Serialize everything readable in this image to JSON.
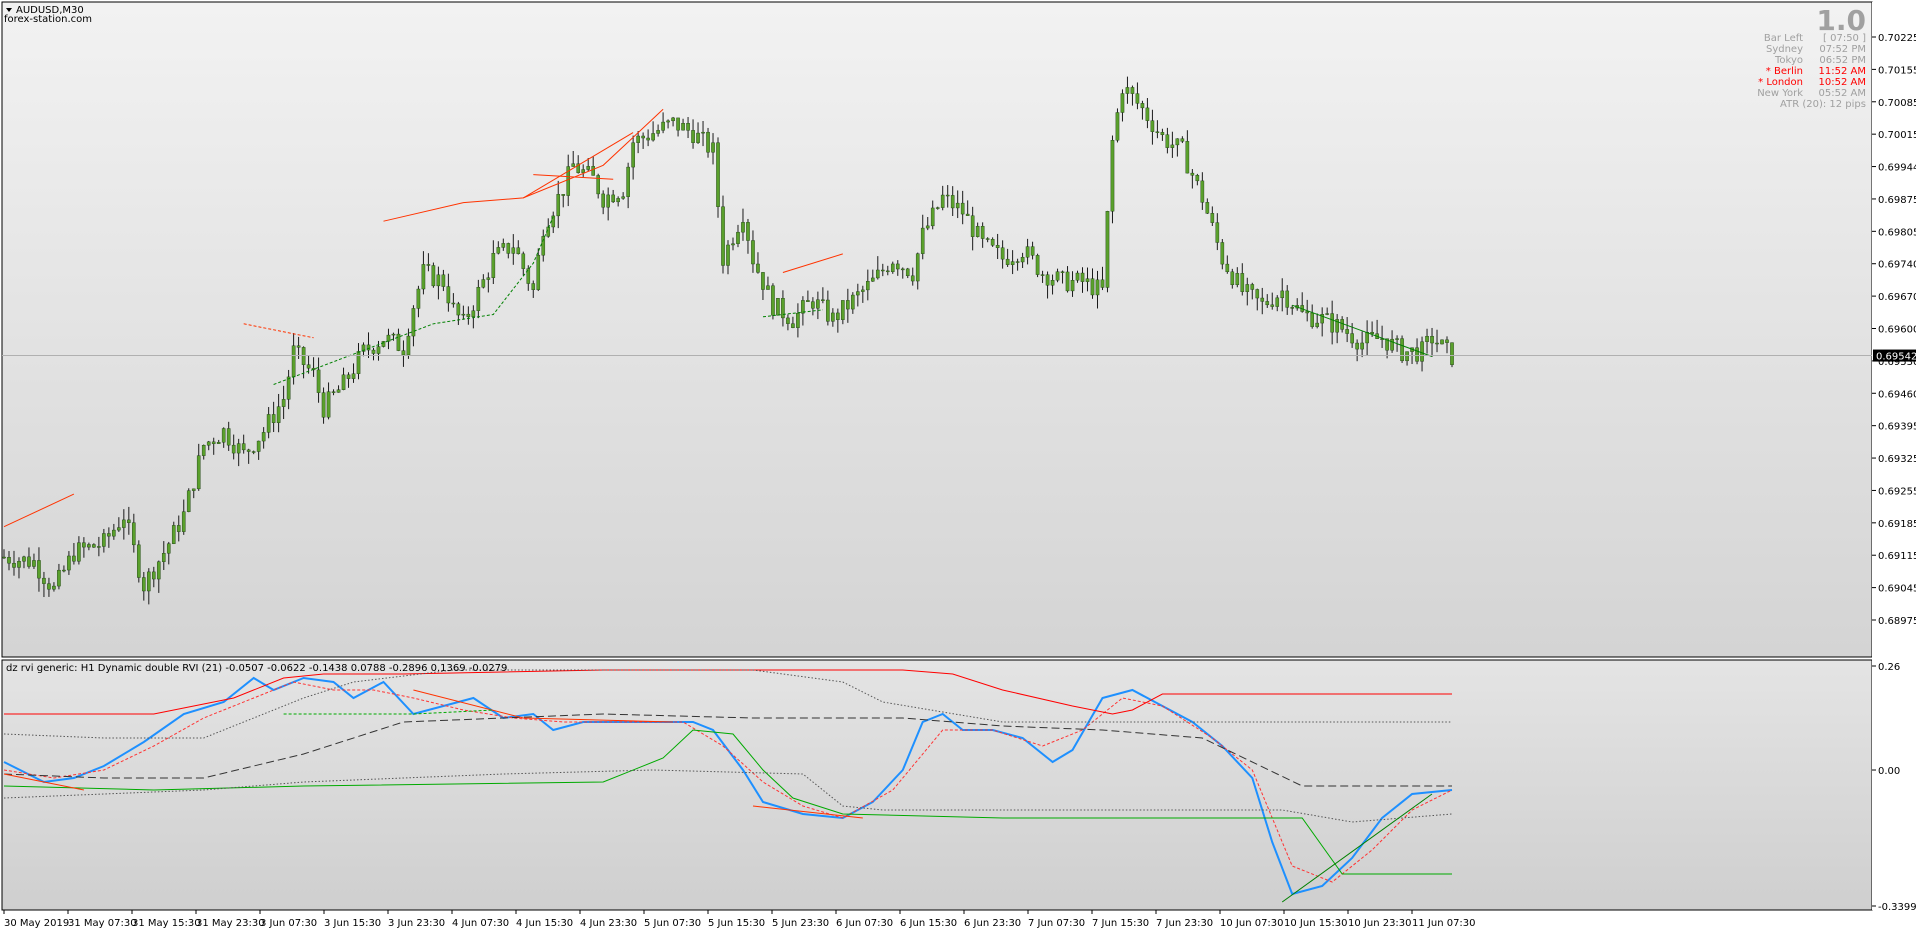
{
  "chart_window": {
    "symbol_label": "AUDUSD,M30",
    "watermark": "forex-station.com",
    "current_price_tag": "0.69542"
  },
  "info_panel": {
    "big_number": "1.0",
    "rows": [
      {
        "label": "Bar Left",
        "value": "[ 07:50 ]",
        "color": "#a0a0a0"
      },
      {
        "label": "Sydney",
        "value": "07:52 PM",
        "color": "#a0a0a0"
      },
      {
        "label": "Tokyo",
        "value": "06:52 PM",
        "color": "#a0a0a0"
      },
      {
        "label": "* Berlin",
        "value": "11:52 AM",
        "color": "#ff0000"
      },
      {
        "label": "* London",
        "value": "10:52 AM",
        "color": "#ff0000"
      },
      {
        "label": "New York",
        "value": "05:52 AM",
        "color": "#a0a0a0"
      }
    ],
    "atr_text": "ATR (20): 12 pips"
  },
  "indicator": {
    "title": "dz rvi generic: H1  Dynamic double RVI (21) -0.0507 -0.0622 -0.1438 0.0788 -0.2896 0.1369 -0.0279",
    "axis_labels": [
      "0.26",
      "0.00",
      "-0.3399"
    ]
  },
  "chart_data": {
    "type": "candlestick",
    "price_axis_labels": [
      "0.70225",
      "0.70155",
      "0.70085",
      "0.70015",
      "0.69944",
      "0.69875",
      "0.69805",
      "0.69740",
      "0.69670",
      "0.69600",
      "0.69530",
      "0.69460",
      "0.69395",
      "0.69325",
      "0.69255",
      "0.69185",
      "0.69115",
      "0.69045",
      "0.68975"
    ],
    "ylim": [
      0.68975,
      0.70225
    ],
    "last_price": 0.69542,
    "time_axis_labels": [
      "30 May 2019",
      "31 May 07:30",
      "31 May 15:30",
      "31 May 23:30",
      "3 Jun 07:30",
      "3 Jun 15:30",
      "3 Jun 23:30",
      "4 Jun 07:30",
      "4 Jun 15:30",
      "4 Jun 23:30",
      "5 Jun 07:30",
      "5 Jun 15:30",
      "5 Jun 23:30",
      "6 Jun 07:30",
      "6 Jun 15:30",
      "6 Jun 23:30",
      "7 Jun 07:30",
      "7 Jun 15:30",
      "7 Jun 23:30",
      "10 Jun 07:30",
      "10 Jun 15:30",
      "10 Jun 23:30",
      "11 Jun 07:30"
    ],
    "close_path": [
      [
        0,
        0.6911
      ],
      [
        6,
        0.691
      ],
      [
        10,
        0.6904
      ],
      [
        14,
        0.6912
      ],
      [
        20,
        0.6914
      ],
      [
        24,
        0.692
      ],
      [
        28,
        0.6905
      ],
      [
        32,
        0.6912
      ],
      [
        36,
        0.692
      ],
      [
        40,
        0.6935
      ],
      [
        44,
        0.6938
      ],
      [
        48,
        0.6933
      ],
      [
        52,
        0.6938
      ],
      [
        56,
        0.6945
      ],
      [
        58,
        0.6955
      ],
      [
        62,
        0.695
      ],
      [
        64,
        0.6943
      ],
      [
        68,
        0.6948
      ],
      [
        72,
        0.6955
      ],
      [
        76,
        0.6958
      ],
      [
        80,
        0.6956
      ],
      [
        82,
        0.6965
      ],
      [
        84,
        0.6972
      ],
      [
        88,
        0.697
      ],
      [
        90,
        0.6964
      ],
      [
        92,
        0.6961
      ],
      [
        96,
        0.697
      ],
      [
        98,
        0.6975
      ],
      [
        102,
        0.6978
      ],
      [
        106,
        0.6968
      ],
      [
        108,
        0.6982
      ],
      [
        112,
        0.699
      ],
      [
        114,
        0.6995
      ],
      [
        118,
        0.6992
      ],
      [
        120,
        0.6988
      ],
      [
        124,
        0.699
      ],
      [
        126,
        0.7
      ],
      [
        130,
        0.7002
      ],
      [
        134,
        0.7004
      ],
      [
        138,
        0.7002
      ],
      [
        142,
        0.6998
      ],
      [
        144,
        0.6975
      ],
      [
        148,
        0.6985
      ],
      [
        150,
        0.6975
      ],
      [
        154,
        0.6965
      ],
      [
        158,
        0.6962
      ],
      [
        162,
        0.6966
      ],
      [
        166,
        0.6962
      ],
      [
        170,
        0.6966
      ],
      [
        174,
        0.697
      ],
      [
        178,
        0.6975
      ],
      [
        182,
        0.6972
      ],
      [
        184,
        0.698
      ],
      [
        188,
        0.6988
      ],
      [
        192,
        0.6985
      ],
      [
        196,
        0.6978
      ],
      [
        200,
        0.6975
      ],
      [
        204,
        0.6977
      ],
      [
        208,
        0.6972
      ],
      [
        212,
        0.697
      ],
      [
        216,
        0.697
      ],
      [
        220,
        0.6968
      ],
      [
        222,
        0.7
      ],
      [
        224,
        0.7012
      ],
      [
        228,
        0.7007
      ],
      [
        232,
        0.7001
      ],
      [
        236,
        0.6998
      ],
      [
        240,
        0.6988
      ],
      [
        244,
        0.6975
      ],
      [
        248,
        0.6968
      ],
      [
        252,
        0.6965
      ],
      [
        256,
        0.6968
      ],
      [
        260,
        0.6963
      ],
      [
        264,
        0.6962
      ],
      [
        268,
        0.696
      ],
      [
        272,
        0.6957
      ],
      [
        276,
        0.6958
      ],
      [
        280,
        0.6955
      ],
      [
        284,
        0.6955
      ],
      [
        286,
        0.6958
      ],
      [
        290,
        0.6954
      ]
    ],
    "price_overlay_lines": [
      {
        "color": "#ff3300",
        "style": "solid",
        "points": [
          [
            0,
            0.69175
          ],
          [
            14,
            0.69245
          ]
        ]
      },
      {
        "color": "#ff3300",
        "style": "solid",
        "points": [
          [
            76,
            0.6983
          ],
          [
            92,
            0.6987
          ],
          [
            104,
            0.6988
          ],
          [
            120,
            0.6995
          ],
          [
            132,
            0.7007
          ]
        ]
      },
      {
        "color": "#ff3300",
        "style": "solid",
        "points": [
          [
            104,
            0.6988
          ],
          [
            126,
            0.7002
          ]
        ]
      },
      {
        "color": "#ff3300",
        "style": "solid",
        "points": [
          [
            106,
            0.6993
          ],
          [
            122,
            0.6992
          ]
        ]
      },
      {
        "color": "#ff3300",
        "style": "dashed",
        "points": [
          [
            48,
            0.6961
          ],
          [
            62,
            0.6958
          ]
        ]
      },
      {
        "color": "#ff3300",
        "style": "solid",
        "points": [
          [
            156,
            0.6972
          ],
          [
            168,
            0.6976
          ]
        ]
      },
      {
        "color": "#008000",
        "style": "dashed",
        "points": [
          [
            54,
            0.6948
          ],
          [
            86,
            0.6961
          ],
          [
            98,
            0.6963
          ],
          [
            106,
            0.6974
          ],
          [
            110,
            0.6984
          ]
        ]
      },
      {
        "color": "#008000",
        "style": "dashed",
        "points": [
          [
            152,
            0.69625
          ],
          [
            164,
            0.6964
          ]
        ]
      },
      {
        "color": "#008000",
        "style": "solid",
        "points": [
          [
            258,
            0.6965
          ],
          [
            286,
            0.6954
          ]
        ]
      }
    ],
    "indicator_series": [
      {
        "color": "#1e90ff",
        "style": "solid",
        "width": 2,
        "points": [
          [
            0,
            0.02
          ],
          [
            8,
            -0.03
          ],
          [
            14,
            -0.02
          ],
          [
            20,
            0.01
          ],
          [
            28,
            0.07
          ],
          [
            36,
            0.14
          ],
          [
            44,
            0.17
          ],
          [
            50,
            0.23
          ],
          [
            54,
            0.2
          ],
          [
            60,
            0.23
          ],
          [
            66,
            0.22
          ],
          [
            70,
            0.18
          ],
          [
            76,
            0.22
          ],
          [
            82,
            0.14
          ],
          [
            88,
            0.16
          ],
          [
            94,
            0.18
          ],
          [
            100,
            0.13
          ],
          [
            106,
            0.14
          ],
          [
            110,
            0.1
          ],
          [
            116,
            0.12
          ],
          [
            122,
            0.12
          ],
          [
            130,
            0.12
          ],
          [
            138,
            0.12
          ],
          [
            142,
            0.1
          ],
          [
            148,
            0.0
          ],
          [
            152,
            -0.08
          ],
          [
            160,
            -0.11
          ],
          [
            168,
            -0.12
          ],
          [
            174,
            -0.08
          ],
          [
            180,
            0.0
          ],
          [
            184,
            0.12
          ],
          [
            188,
            0.14
          ],
          [
            192,
            0.1
          ],
          [
            198,
            0.1
          ],
          [
            204,
            0.08
          ],
          [
            210,
            0.02
          ],
          [
            214,
            0.05
          ],
          [
            220,
            0.18
          ],
          [
            226,
            0.2
          ],
          [
            232,
            0.16
          ],
          [
            238,
            0.12
          ],
          [
            244,
            0.06
          ],
          [
            250,
            -0.02
          ],
          [
            254,
            -0.18
          ],
          [
            258,
            -0.31
          ],
          [
            264,
            -0.29
          ],
          [
            270,
            -0.22
          ],
          [
            276,
            -0.12
          ],
          [
            282,
            -0.06
          ],
          [
            290,
            -0.05
          ]
        ]
      },
      {
        "color": "#ff3333",
        "style": "dashed",
        "points": [
          [
            0,
            0.0
          ],
          [
            10,
            -0.02
          ],
          [
            20,
            0.0
          ],
          [
            30,
            0.06
          ],
          [
            40,
            0.13
          ],
          [
            50,
            0.18
          ],
          [
            58,
            0.22
          ],
          [
            66,
            0.2
          ],
          [
            74,
            0.2
          ],
          [
            82,
            0.18
          ],
          [
            92,
            0.15
          ],
          [
            102,
            0.13
          ],
          [
            112,
            0.12
          ],
          [
            124,
            0.12
          ],
          [
            136,
            0.12
          ],
          [
            144,
            0.06
          ],
          [
            152,
            -0.03
          ],
          [
            160,
            -0.09
          ],
          [
            168,
            -0.12
          ],
          [
            178,
            -0.05
          ],
          [
            188,
            0.1
          ],
          [
            198,
            0.1
          ],
          [
            208,
            0.06
          ],
          [
            216,
            0.1
          ],
          [
            224,
            0.18
          ],
          [
            232,
            0.16
          ],
          [
            242,
            0.08
          ],
          [
            250,
            0.0
          ],
          [
            258,
            -0.24
          ],
          [
            266,
            -0.28
          ],
          [
            274,
            -0.2
          ],
          [
            282,
            -0.1
          ],
          [
            290,
            -0.05
          ]
        ]
      },
      {
        "color": "#ff0000",
        "style": "solid",
        "points": [
          [
            0,
            0.14
          ],
          [
            30,
            0.14
          ],
          [
            46,
            0.18
          ],
          [
            56,
            0.23
          ],
          [
            64,
            0.24
          ],
          [
            80,
            0.24
          ],
          [
            120,
            0.25
          ],
          [
            180,
            0.25
          ],
          [
            190,
            0.24
          ],
          [
            200,
            0.2
          ],
          [
            214,
            0.16
          ],
          [
            222,
            0.14
          ],
          [
            226,
            0.15
          ],
          [
            232,
            0.19
          ],
          [
            290,
            0.19
          ]
        ]
      },
      {
        "color": "#00aa00",
        "style": "solid",
        "points": [
          [
            0,
            -0.04
          ],
          [
            30,
            -0.05
          ],
          [
            60,
            -0.04
          ],
          [
            120,
            -0.03
          ],
          [
            132,
            0.03
          ],
          [
            138,
            0.1
          ],
          [
            146,
            0.09
          ],
          [
            152,
            0.0
          ],
          [
            158,
            -0.07
          ],
          [
            168,
            -0.11
          ],
          [
            200,
            -0.12
          ],
          [
            260,
            -0.12
          ],
          [
            268,
            -0.26
          ],
          [
            290,
            -0.26
          ]
        ]
      },
      {
        "color": "#333333",
        "style": "longdash",
        "points": [
          [
            0,
            -0.01
          ],
          [
            20,
            -0.02
          ],
          [
            40,
            -0.02
          ],
          [
            60,
            0.04
          ],
          [
            80,
            0.12
          ],
          [
            100,
            0.13
          ],
          [
            120,
            0.14
          ],
          [
            150,
            0.13
          ],
          [
            180,
            0.13
          ],
          [
            200,
            0.11
          ],
          [
            220,
            0.1
          ],
          [
            240,
            0.08
          ],
          [
            260,
            -0.04
          ],
          [
            290,
            -0.04
          ]
        ]
      },
      {
        "color": "#555555",
        "style": "dotted",
        "points": [
          [
            0,
            0.09
          ],
          [
            20,
            0.08
          ],
          [
            40,
            0.08
          ],
          [
            60,
            0.18
          ],
          [
            70,
            0.22
          ],
          [
            90,
            0.25
          ],
          [
            150,
            0.25
          ],
          [
            168,
            0.22
          ],
          [
            176,
            0.17
          ],
          [
            200,
            0.12
          ],
          [
            226,
            0.12
          ],
          [
            290,
            0.12
          ]
        ]
      },
      {
        "color": "#555555",
        "style": "dotted",
        "points": [
          [
            0,
            -0.07
          ],
          [
            20,
            -0.06
          ],
          [
            40,
            -0.05
          ],
          [
            60,
            -0.03
          ],
          [
            100,
            -0.01
          ],
          [
            130,
            0.0
          ],
          [
            160,
            -0.01
          ],
          [
            168,
            -0.09
          ],
          [
            176,
            -0.1
          ],
          [
            220,
            -0.1
          ],
          [
            256,
            -0.1
          ],
          [
            270,
            -0.13
          ],
          [
            290,
            -0.11
          ]
        ]
      },
      {
        "color": "#ff3300",
        "style": "solid",
        "points": [
          [
            82,
            0.2
          ],
          [
            104,
            0.13
          ],
          [
            134,
            0.12
          ]
        ]
      },
      {
        "color": "#ff3300",
        "style": "solid",
        "points": [
          [
            0,
            -0.01
          ],
          [
            16,
            -0.05
          ]
        ]
      },
      {
        "color": "#008000",
        "style": "solid",
        "points": [
          [
            256,
            -0.33
          ],
          [
            286,
            -0.06
          ]
        ]
      },
      {
        "color": "#00aa00",
        "style": "dashed",
        "points": [
          [
            56,
            0.14
          ],
          [
            82,
            0.14
          ],
          [
            98,
            0.15
          ]
        ]
      },
      {
        "color": "#ff3300",
        "style": "solid",
        "points": [
          [
            150,
            -0.09
          ],
          [
            172,
            -0.12
          ]
        ]
      }
    ]
  }
}
